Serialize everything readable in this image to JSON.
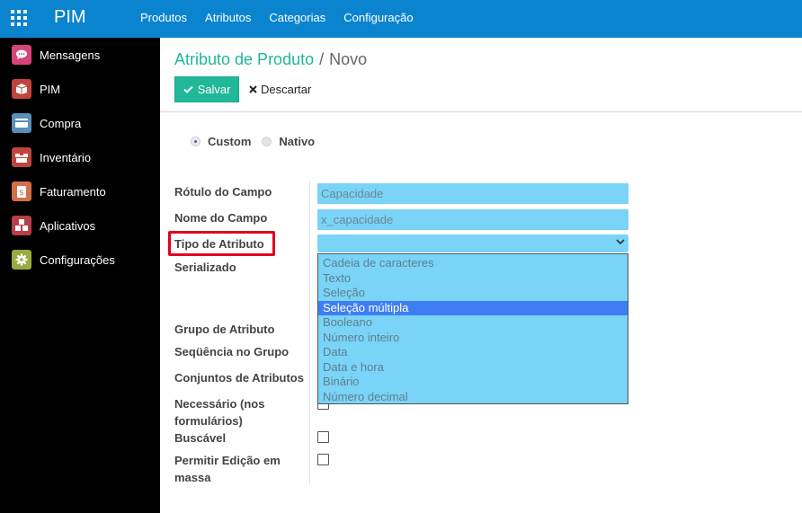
{
  "topbar": {
    "brand": "PIM",
    "menu": [
      "Produtos",
      "Atributos",
      "Categorias",
      "Configuração"
    ]
  },
  "sidebar": {
    "items": [
      {
        "label": "Mensagens",
        "icon": "chat-bubble-icon",
        "color": "#d6447a"
      },
      {
        "label": "PIM",
        "icon": "box-icon",
        "color": "#c0443d"
      },
      {
        "label": "Compra",
        "icon": "credit-card-icon",
        "color": "#5a8fb7"
      },
      {
        "label": "Inventário",
        "icon": "boxes-icon",
        "color": "#c0443d"
      },
      {
        "label": "Faturamento",
        "icon": "invoice-icon",
        "color": "#d3704a"
      },
      {
        "label": "Aplicativos",
        "icon": "cubes-icon",
        "color": "#b73f48"
      },
      {
        "label": "Configurações",
        "icon": "gear-icon",
        "color": "#9aaa3e"
      }
    ]
  },
  "breadcrumb": {
    "parent": "Atributo de Produto",
    "separator": "/",
    "current": "Novo"
  },
  "actions": {
    "save_label": "Salvar",
    "discard_label": "Descartar"
  },
  "origin_radio": {
    "options": [
      "Custom",
      "Nativo"
    ],
    "selected": "Custom"
  },
  "form": {
    "labels": {
      "rotulo": "Rótulo do Campo",
      "nome": "Nome do Campo",
      "tipo": "Tipo de Atributo",
      "serializado": "Serializado",
      "grupo": "Grupo de Atributo",
      "sequencia": "Seqüência no Grupo",
      "conjuntos": "Conjuntos de Atributos",
      "necessario": "Necessário (nos formulários)",
      "buscavel": "Buscável",
      "permitir": "Permitir Edição em massa"
    },
    "rotulo_placeholder": "Capacidade",
    "nome_value": "x_capacidade",
    "tipo_options": [
      "Cadeia de caracteres",
      "Texto",
      "Seleção",
      "Seleção múltipla",
      "Booleano",
      "Número inteiro",
      "Data",
      "Data e hora",
      "Binário",
      "Número decimal"
    ],
    "tipo_highlighted": "Seleção múltipla"
  }
}
